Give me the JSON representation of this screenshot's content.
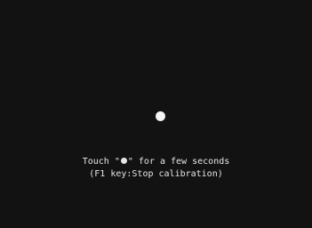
{
  "calibration": {
    "line1_before": "Touch \"",
    "line1_symbol": "●",
    "line1_after": "\" for a few seconds",
    "line2": "(F1 key:Stop calibration)"
  },
  "colors": {
    "background": "#121212",
    "target": "#f4f4f4",
    "text": "#e6e6e6"
  },
  "icons": {
    "target": "filled-circle",
    "inline_symbol": "filled-circle"
  }
}
